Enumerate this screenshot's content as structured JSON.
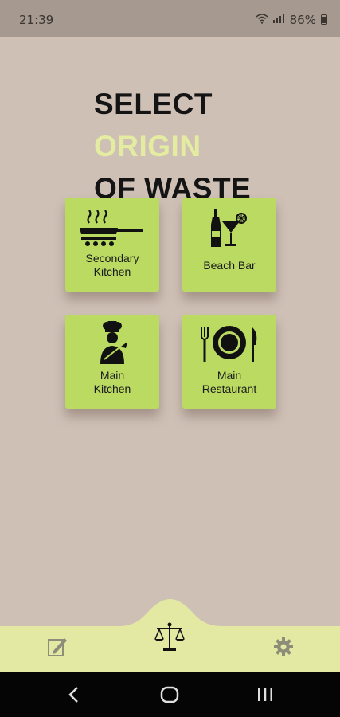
{
  "status": {
    "time": "21:39",
    "battery_pct": "86%"
  },
  "title": {
    "line1": "SELECT",
    "line2": "ORIGIN",
    "line3": "OF WASTE"
  },
  "tiles": [
    {
      "line1": "Secondary",
      "line2": "Kitchen",
      "icon": "frying-pan-icon"
    },
    {
      "line1": "Beach Bar",
      "line2": "",
      "icon": "bottle-cocktail-icon"
    },
    {
      "line1": "Main",
      "line2": "Kitchen",
      "icon": "chef-icon"
    },
    {
      "line1": "Main",
      "line2": "Restaurant",
      "icon": "plate-cutlery-icon"
    }
  ],
  "bottom_nav": {
    "left_icon": "edit-icon",
    "center_icon": "scale-icon",
    "right_icon": "gear-icon"
  },
  "system_nav": {
    "back": "back-icon",
    "home": "home-icon",
    "recents": "recents-icon"
  },
  "colors": {
    "background": "#cfc0b6",
    "tile": "#bada62",
    "accent_text": "#e3eca0",
    "bottom_bar": "#e3e9a2",
    "status_bar": "#a59990"
  }
}
